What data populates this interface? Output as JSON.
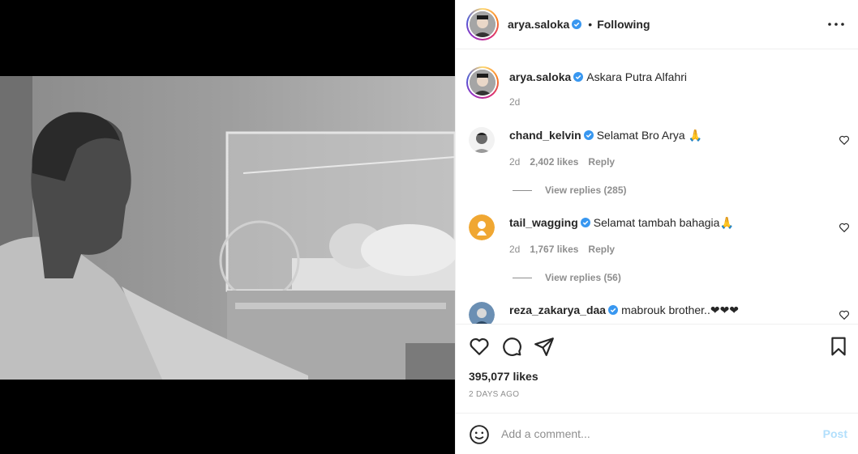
{
  "post": {
    "author": "arya.saloka",
    "follow_sep": "•",
    "follow_status": "Following",
    "caption": "Askara Putra Alfahri",
    "caption_age": "2d",
    "likes": "395,077 likes",
    "date": "2 DAYS AGO"
  },
  "comments": [
    {
      "username": "chand_kelvin",
      "text": "Selamat Bro Arya 🙏",
      "age": "2d",
      "likes": "2,402 likes",
      "reply": "Reply",
      "view_replies": "View replies (285)"
    },
    {
      "username": "tail_wagging",
      "text": "Selamat tambah bahagia🙏",
      "age": "2d",
      "likes": "1,767 likes",
      "reply": "Reply",
      "view_replies": "View replies (56)"
    },
    {
      "username": "reza_zakarya_daa",
      "text": "mabrouk brother..❤❤❤"
    }
  ],
  "composer": {
    "placeholder": "Add a comment...",
    "post_label": "Post"
  },
  "icons": {
    "verified": "verified-badge-icon",
    "more": "more-options-icon",
    "like": "heart-icon",
    "comment": "comment-icon",
    "share": "share-icon",
    "save": "bookmark-icon",
    "emoji": "emoji-icon"
  },
  "colors": {
    "verified_blue": "#3897f0",
    "post_button_disabled": "#b2dffc",
    "meta_gray": "#8e8e8e",
    "text_dark": "#262626"
  }
}
